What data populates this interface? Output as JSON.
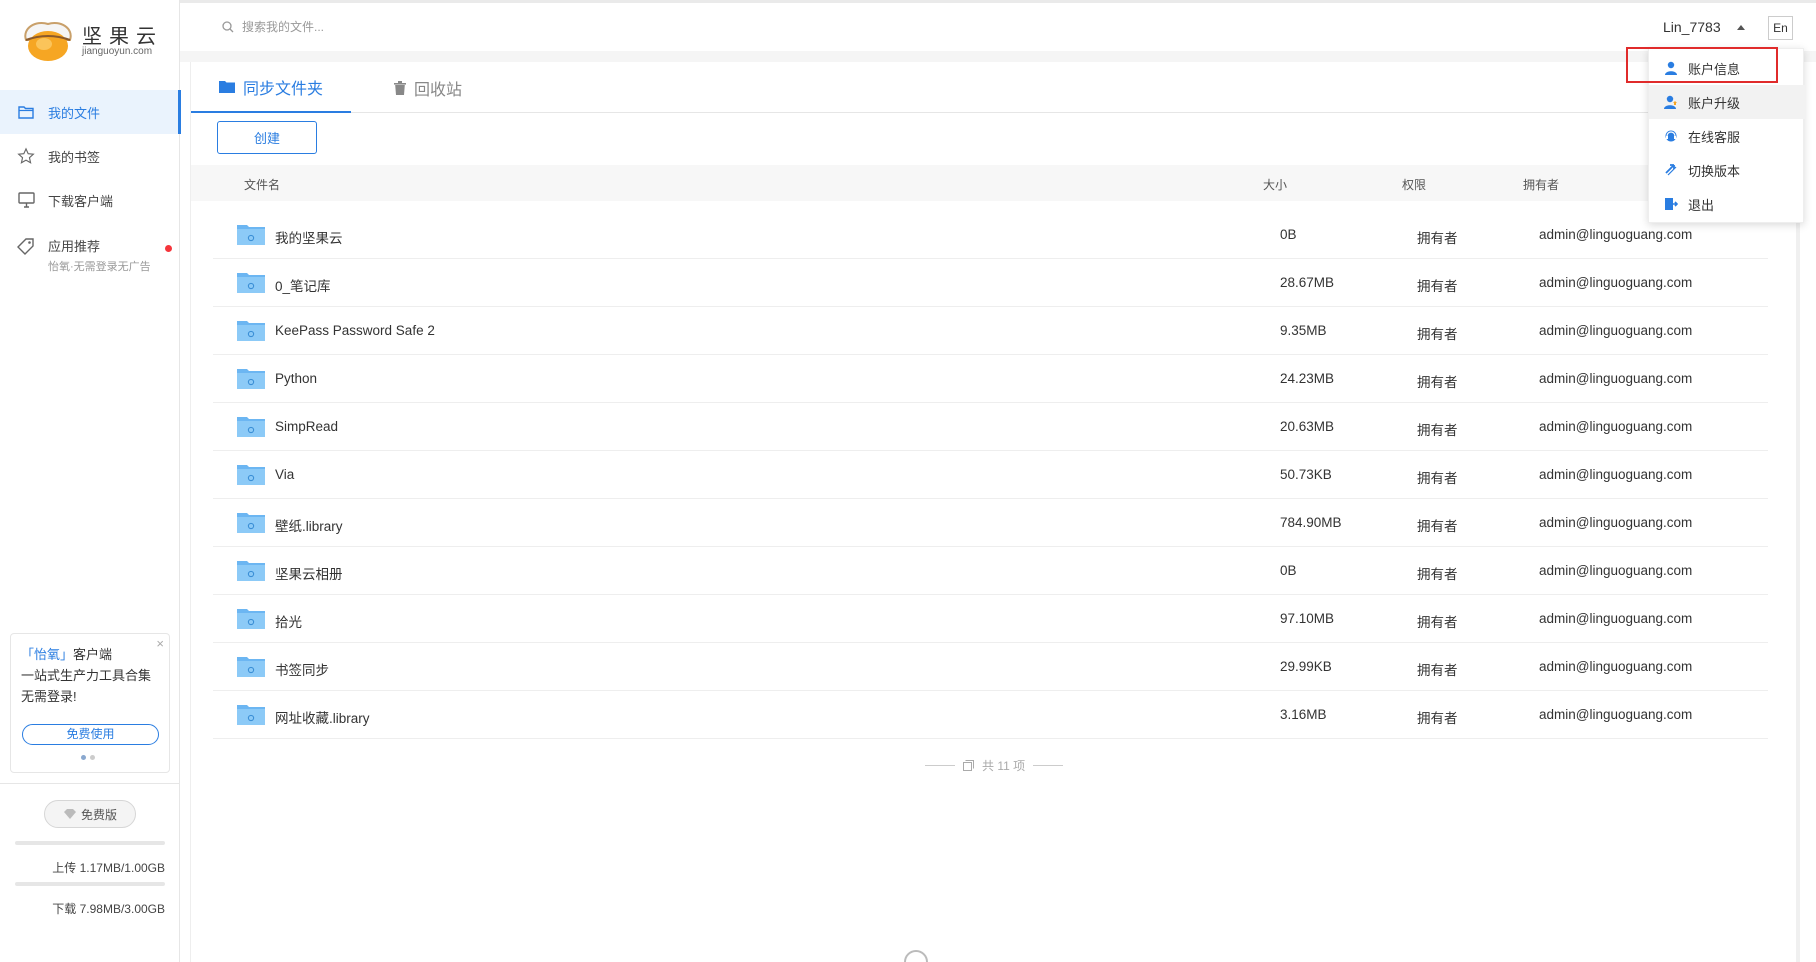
{
  "brand": {
    "name": "坚果云",
    "domain": "jianguoyun.com"
  },
  "search": {
    "placeholder": "搜索我的文件..."
  },
  "user": {
    "name": "Lin_7783",
    "lang_button": "En"
  },
  "sidebar": {
    "items": [
      {
        "label": "我的文件",
        "icon": "folder-icon",
        "active": true
      },
      {
        "label": "我的书签",
        "icon": "star-icon"
      },
      {
        "label": "下载客户端",
        "icon": "monitor-icon"
      },
      {
        "label": "应用推荐",
        "sub": "怡氧·无需登录无广告",
        "icon": "tag-icon",
        "badge": "red-dot"
      }
    ],
    "promo": {
      "close": "×",
      "highlight": "「怡氧」",
      "line1_rest": "客户端",
      "line2": "一站式生产力工具合集 无需登录!",
      "button": "免费使用"
    },
    "plan": "免费版",
    "upload": "上传 1.17MB/1.00GB",
    "download": "下载 7.98MB/3.00GB"
  },
  "tabs": [
    {
      "label": "同步文件夹",
      "icon": "folder-icon",
      "active": true
    },
    {
      "label": "回收站",
      "icon": "trash-icon"
    }
  ],
  "toolbar": {
    "create": "创建"
  },
  "table": {
    "headers": {
      "name": "文件名",
      "size": "大小",
      "permission": "权限",
      "owner": "拥有者"
    },
    "rows": [
      {
        "name": "我的坚果云",
        "size": "0B",
        "perm": "拥有者",
        "owner": "admin@linguoguang.com"
      },
      {
        "name": "0_笔记库",
        "size": "28.67MB",
        "perm": "拥有者",
        "owner": "admin@linguoguang.com"
      },
      {
        "name": "KeePass Password Safe 2",
        "size": "9.35MB",
        "perm": "拥有者",
        "owner": "admin@linguoguang.com"
      },
      {
        "name": "Python",
        "size": "24.23MB",
        "perm": "拥有者",
        "owner": "admin@linguoguang.com"
      },
      {
        "name": "SimpRead",
        "size": "20.63MB",
        "perm": "拥有者",
        "owner": "admin@linguoguang.com"
      },
      {
        "name": "Via",
        "size": "50.73KB",
        "perm": "拥有者",
        "owner": "admin@linguoguang.com"
      },
      {
        "name": "壁纸.library",
        "size": "784.90MB",
        "perm": "拥有者",
        "owner": "admin@linguoguang.com"
      },
      {
        "name": "坚果云相册",
        "size": "0B",
        "perm": "拥有者",
        "owner": "admin@linguoguang.com"
      },
      {
        "name": "拾光",
        "size": "97.10MB",
        "perm": "拥有者",
        "owner": "admin@linguoguang.com"
      },
      {
        "name": "书签同步",
        "size": "29.99KB",
        "perm": "拥有者",
        "owner": "admin@linguoguang.com"
      },
      {
        "name": "网址收藏.library",
        "size": "3.16MB",
        "perm": "拥有者",
        "owner": "admin@linguoguang.com"
      }
    ],
    "total": "共 11 项"
  },
  "dropdown": {
    "items": [
      {
        "label": "账户信息",
        "icon": "user-icon",
        "highlighted": true
      },
      {
        "label": "账户升级",
        "icon": "user-upgrade-icon",
        "hover": true
      },
      {
        "label": "在线客服",
        "icon": "headset-icon"
      },
      {
        "label": "切换版本",
        "icon": "swap-icon"
      },
      {
        "label": "退出",
        "icon": "logout-icon"
      }
    ]
  },
  "colors": {
    "accent": "#2a7de1",
    "folder": "#6cb6f2",
    "highlight_border": "#e02b2b"
  }
}
